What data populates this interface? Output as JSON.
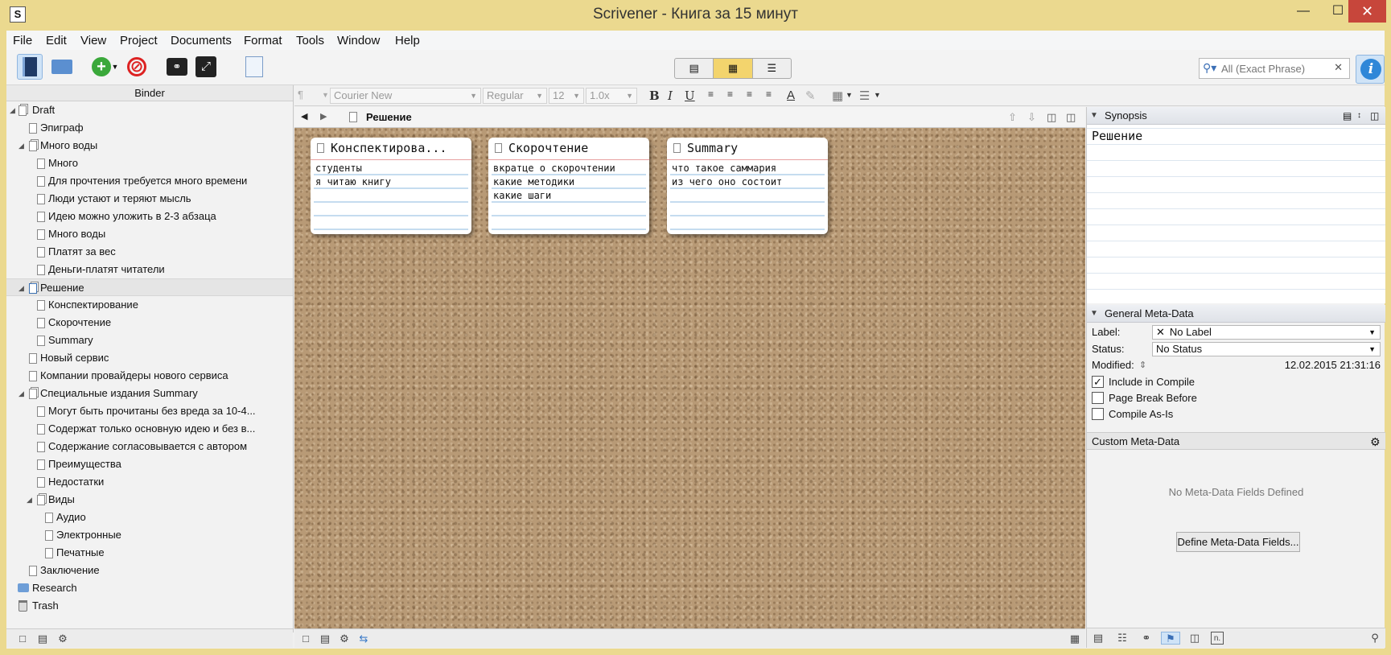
{
  "window": {
    "title": "Scrivener - Книга за 15 минут"
  },
  "menu": [
    "File",
    "Edit",
    "View",
    "Project",
    "Documents",
    "Format",
    "Tools",
    "Window",
    "Help"
  ],
  "search": {
    "placeholder": "All (Exact Phrase)"
  },
  "binder": {
    "header": "Binder",
    "items": [
      {
        "label": "Draft"
      },
      {
        "label": "Эпиграф"
      },
      {
        "label": "Много воды"
      },
      {
        "label": "Много"
      },
      {
        "label": "Для прочтения требуется много времени"
      },
      {
        "label": "Люди устают и теряют мысль"
      },
      {
        "label": "Идею можно уложить в 2-3 абзаца"
      },
      {
        "label": "Много воды"
      },
      {
        "label": "Платят за вес"
      },
      {
        "label": "Деньги-платят читатели"
      },
      {
        "label": "Решение"
      },
      {
        "label": "Конспектирование"
      },
      {
        "label": "Скорочтение"
      },
      {
        "label": "Summary"
      },
      {
        "label": "Новый сервис"
      },
      {
        "label": "Компании провайдеры нового сервиса"
      },
      {
        "label": "Специальные издания Summary"
      },
      {
        "label": "Могут быть прочитаны без вреда за 10-4..."
      },
      {
        "label": "Содержат только основную идею и без в..."
      },
      {
        "label": "Содержание согласовывается с автором"
      },
      {
        "label": "Преимущества"
      },
      {
        "label": "Недостатки"
      },
      {
        "label": "Виды"
      },
      {
        "label": "Аудио"
      },
      {
        "label": "Электронные"
      },
      {
        "label": "Печатные"
      },
      {
        "label": "Заключение"
      },
      {
        "label": "Research"
      },
      {
        "label": "Trash"
      }
    ]
  },
  "format_bar": {
    "font": "Courier New",
    "style": "Regular",
    "size": "12",
    "spacing": "1.0x"
  },
  "editor": {
    "title": "Решение",
    "cards": [
      {
        "title": "Конспектирова...",
        "lines": [
          "студенты",
          "я читаю книгу"
        ]
      },
      {
        "title": "Скорочтение",
        "lines": [
          "вкратце о скорочтении",
          "какие методики",
          "какие шаги"
        ]
      },
      {
        "title": "Summary",
        "lines": [
          "что такое саммария",
          "из чего оно состоит"
        ]
      }
    ]
  },
  "inspector": {
    "synopsis_header": "Synopsis",
    "synopsis_text": "Решение",
    "meta_header": "General Meta-Data",
    "label_key": "Label:",
    "label_value": "No Label",
    "status_key": "Status:",
    "status_value": "No Status",
    "modified_key": "Modified:",
    "modified_value": "12.02.2015 21:31:16",
    "include_compile": "Include in Compile",
    "page_break": "Page Break Before",
    "compile_as_is": "Compile As-Is",
    "custom_header": "Custom Meta-Data",
    "no_fields": "No Meta-Data Fields Defined",
    "define_button": "Define Meta-Data Fields..."
  }
}
